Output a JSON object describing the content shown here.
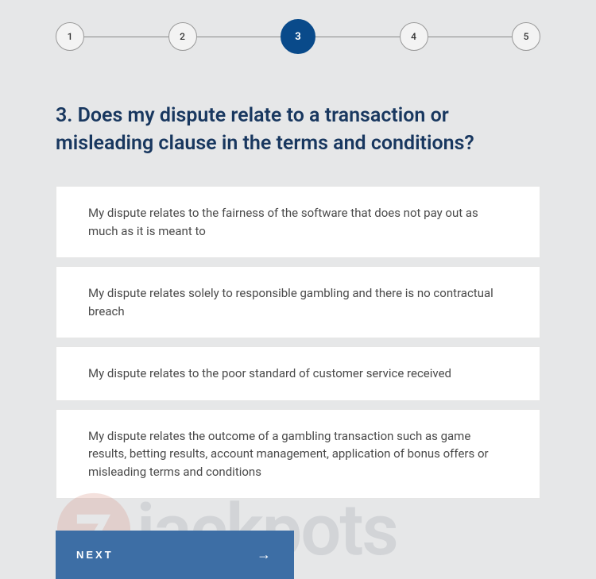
{
  "stepper": {
    "steps": [
      {
        "label": "1",
        "active": false
      },
      {
        "label": "2",
        "active": false
      },
      {
        "label": "3",
        "active": true
      },
      {
        "label": "4",
        "active": false
      },
      {
        "label": "5",
        "active": false
      }
    ]
  },
  "question": {
    "title": "3. Does my dispute relate to a transaction or misleading clause in the terms and conditions?"
  },
  "options": [
    {
      "text": "My dispute relates to the fairness of the software that does not pay out as much as it is meant to"
    },
    {
      "text": "My dispute relates solely to responsible gambling and there is no contractual breach"
    },
    {
      "text": "My dispute relates to the poor standard of customer service received"
    },
    {
      "text": "My dispute relates the outcome of a gambling transaction such as game results, betting results, account management, application of bonus offers or misleading terms and conditions"
    }
  ],
  "next": {
    "label": "NEXT"
  },
  "watermark": {
    "text": "jackpots"
  }
}
